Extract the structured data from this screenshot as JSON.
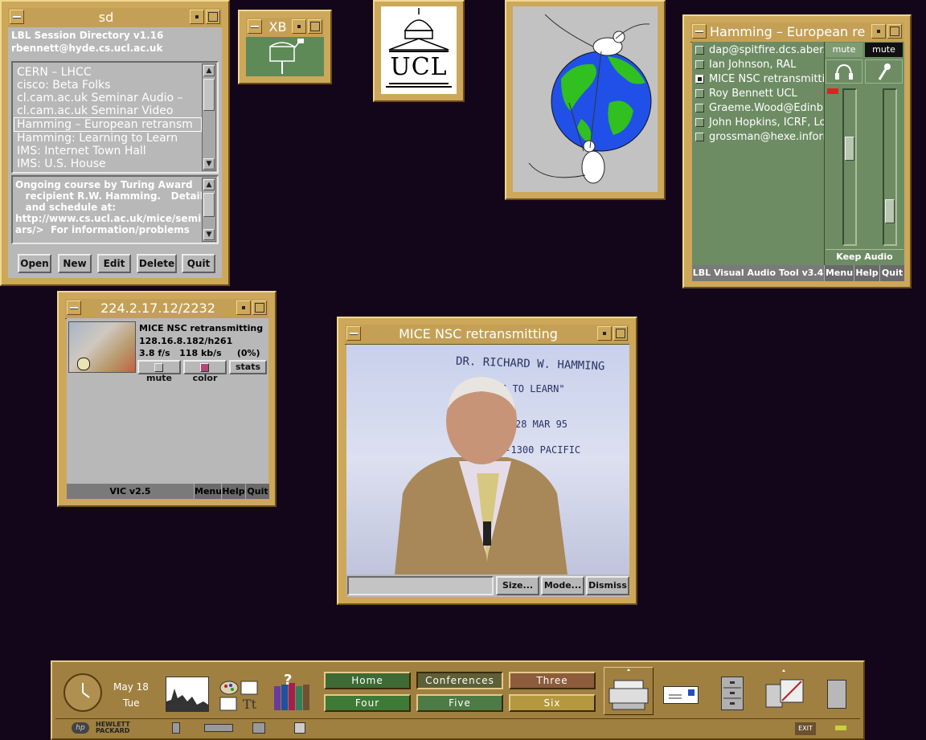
{
  "sd": {
    "title": "sd",
    "header1": "LBL Session Directory   v1.16",
    "header2": "rbennett@hyde.cs.ucl.ac.uk",
    "sessions": [
      "CERN – LHCC",
      "cisco: Beta Folks",
      "cl.cam.ac.uk Seminar Audio –",
      "cl.cam.ac.uk Seminar Video",
      "Hamming – European retransm",
      "Hamming:  Learning to Learn",
      "IMS: Internet Town Hall",
      "IMS: U.S. House"
    ],
    "selected_index": 4,
    "description": [
      "Ongoing course by Turing Award",
      "   recipient R.W. Hamming.   Details",
      "   and schedule at:",
      "http://www.cs.ucl.ac.uk/mice/semin",
      "ars/>  For information/problems"
    ],
    "buttons": [
      "Open",
      "New",
      "Edit",
      "Delete",
      "Quit"
    ]
  },
  "xb": {
    "title": "XB"
  },
  "ucl": {
    "text": "UCL"
  },
  "vat": {
    "title": "Hamming – European re",
    "participants": [
      {
        "name": "dap@spitfire.dcs.aber.a",
        "checked": false
      },
      {
        "name": "Ian Johnson, RAL",
        "checked": false
      },
      {
        "name": "MICE NSC retransmittin",
        "checked": true
      },
      {
        "name": "Roy Bennett UCL",
        "checked": false
      },
      {
        "name": "Graeme.Wood@Edinbur",
        "checked": false
      },
      {
        "name": "John Hopkins, ICRF, Lo",
        "checked": false
      },
      {
        "name": "grossman@hexe.inform",
        "checked": false
      }
    ],
    "mute_left": "mute",
    "mute_right": "mute",
    "keep_audio": "Keep Audio",
    "status": "LBL Visual Audio Tool v3.4",
    "menu": "Menu",
    "help": "Help",
    "quit": "Quit",
    "headphone_volume": 0.36,
    "mic_volume": 0.16
  },
  "vic": {
    "title": "224.2.17.12/2232",
    "stream_name": "MICE NSC retransmitting",
    "stream_addr": "128.16.8.182/h261",
    "stream_rate": "3.8 f/s   118 kb/s     (0%)",
    "mute": "mute",
    "color": "color",
    "stats": "stats",
    "status": "VIC v2.5",
    "menu": "Menu",
    "help": "Help",
    "quit": "Quit"
  },
  "video": {
    "title": "MICE NSC retransmitting",
    "board_lines": [
      "DR. RICHARD W. HAMMING",
      "ARNING TO LEARN\"",
      "28 MAR 95",
      "0-1300 PACIFIC"
    ],
    "size": "Size...",
    "mode": "Mode...",
    "dismiss": "Dismiss"
  },
  "panel": {
    "date": "May 18",
    "day": "Tue",
    "workspaces": [
      "Home",
      "Conferences",
      "Three",
      "Four",
      "Five",
      "Six"
    ],
    "workspace_colors": [
      "#3e6a36",
      "#5c6038",
      "#8c5c3c",
      "#3e7a36",
      "#4e7a46",
      "#b49840"
    ],
    "active_workspace": 1,
    "exit": "EXIT",
    "brand": [
      "HEWLETT",
      "PACKARD"
    ],
    "help_glyph": "?",
    "hp_logo": "hp"
  }
}
